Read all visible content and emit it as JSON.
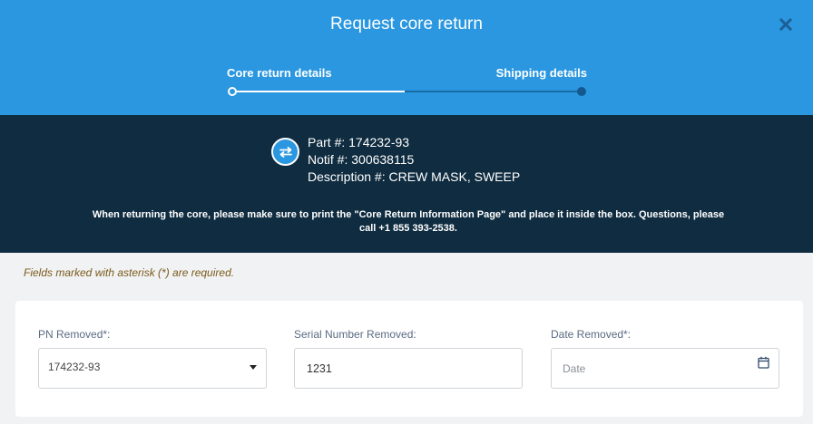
{
  "header": {
    "title": "Request core return",
    "steps": [
      {
        "label": "Core return details",
        "state": "active"
      },
      {
        "label": "Shipping details",
        "state": "pending"
      }
    ],
    "progress": 0.5
  },
  "part_info": {
    "part": "Part #: 174232-93",
    "notif": "Notif #: 300638115",
    "description": "Description #: CREW MASK, SWEEP",
    "notice_line1": "When returning the core, please make sure to print the \"Core Return Information Page\" and place it inside the box. Questions, please",
    "notice_line2": "call +1 855 393-2538."
  },
  "form": {
    "required_note": "Fields marked with asterisk (*) are required.",
    "pn_removed": {
      "label": "PN Removed",
      "required_mark": "*:",
      "value": "174232-93"
    },
    "serial_removed": {
      "label": "Serial Number Removed:",
      "value": "1231"
    },
    "date_removed": {
      "label": "Date Removed",
      "required_mark": "*:",
      "placeholder": "Date",
      "value": ""
    }
  },
  "colors": {
    "header_blue": "#2a97e0",
    "info_navy": "#0f2c40",
    "page_bg": "#f1f2f3"
  },
  "icons": [
    "close-icon",
    "swap-arrows-icon",
    "dropdown-caret-icon",
    "calendar-icon"
  ]
}
